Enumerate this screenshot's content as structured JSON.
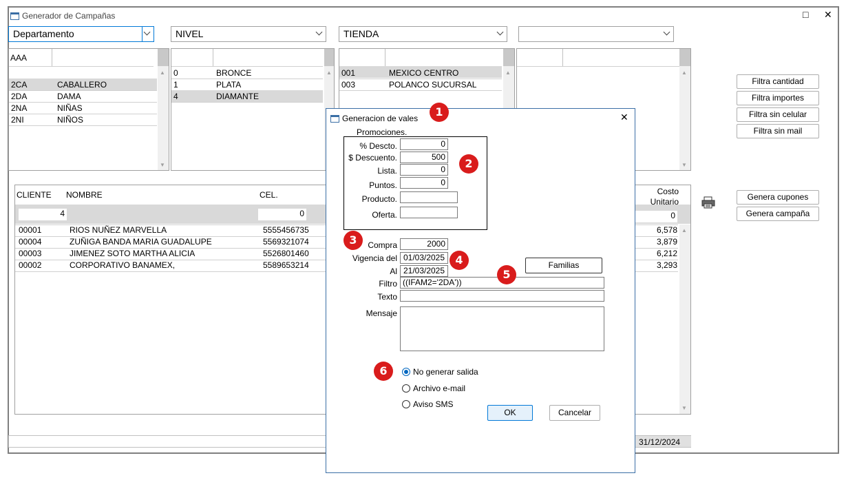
{
  "window": {
    "title": "Generador de Campañas",
    "maximize_icon": "□",
    "close_icon": "✕"
  },
  "combos": [
    {
      "value": "Departamento"
    },
    {
      "value": "NIVEL"
    },
    {
      "value": "TIENDA"
    },
    {
      "value": ""
    }
  ],
  "dept_grid": {
    "header": "AAA",
    "rows": [
      {
        "code": "2CA",
        "name": "CABALLERO"
      },
      {
        "code": "2DA",
        "name": "DAMA"
      },
      {
        "code": "2NA",
        "name": "NIÑAS"
      },
      {
        "code": "2NI",
        "name": "NIÑOS"
      }
    ]
  },
  "nivel_grid": {
    "rows": [
      {
        "code": "0",
        "name": "BRONCE"
      },
      {
        "code": "1",
        "name": "PLATA"
      },
      {
        "code": "4",
        "name": "DIAMANTE"
      }
    ]
  },
  "tienda_grid": {
    "rows": [
      {
        "code": "001",
        "name": "MEXICO CENTRO"
      },
      {
        "code": "003",
        "name": "POLANCO SUCURSAL"
      }
    ]
  },
  "filter_buttons": [
    "Filtra cantidad",
    "Filtra importes",
    "Filtra sin celular",
    "Filtra sin mail"
  ],
  "action_buttons": [
    "Genera cupones",
    "Genera campaña"
  ],
  "clients": {
    "headers": {
      "cliente": "CLIENTE",
      "nombre": "NOMBRE",
      "cel": "CEL.",
      "costo": "Costo Unitario"
    },
    "filter_cliente": "4",
    "filter_cel": "0",
    "filter_costo": "0",
    "rows": [
      {
        "cliente": "00001",
        "nombre": "RIOS NUÑEZ MARVELLA",
        "cel": "5555456735",
        "costo": "6,578"
      },
      {
        "cliente": "00004",
        "nombre": "ZUÑIGA BANDA MARIA GUADALUPE",
        "cel": "5569321074",
        "costo": "3,879"
      },
      {
        "cliente": "00003",
        "nombre": "JIMENEZ SOTO MARTHA ALICIA",
        "cel": "5526801460",
        "costo": "6,212"
      },
      {
        "cliente": "00002",
        "nombre": "CORPORATIVO BANAMEX,",
        "cel": "5589653214",
        "costo": "3,293"
      }
    ],
    "status_date": "31/12/2024"
  },
  "dialog": {
    "title": "Generacion de vales",
    "close_icon": "✕",
    "promociones_label": "Promociones.",
    "fields": {
      "pct_descto": {
        "label": "% Descto.",
        "value": "0"
      },
      "descuento": {
        "label": "$ Descuento.",
        "value": "500"
      },
      "lista": {
        "label": "Lista.",
        "value": "0"
      },
      "puntos": {
        "label": "Puntos.",
        "value": "0"
      },
      "producto": {
        "label": "Producto.",
        "value": ""
      },
      "oferta": {
        "label": "Oferta.",
        "value": ""
      },
      "compra": {
        "label": "Compra",
        "value": "2000"
      },
      "vigencia": {
        "label": "Vigencia del",
        "value": "01/03/2025"
      },
      "al": {
        "label": "Al",
        "value": "21/03/2025"
      },
      "filtro": {
        "label": "Filtro",
        "value": "((IFAM2='2DA'))"
      },
      "texto": {
        "label": "Texto",
        "value": ""
      },
      "mensaje": {
        "label": "Mensaje",
        "value": ""
      }
    },
    "familias_label": "Familias",
    "radios": [
      {
        "label": "No generar salida",
        "checked": true
      },
      {
        "label": "Archivo e-mail",
        "checked": false
      },
      {
        "label": "Aviso SMS",
        "checked": false
      }
    ],
    "ok_label": "OK",
    "cancel_label": "Cancelar"
  },
  "badges": [
    "1",
    "2",
    "3",
    "4",
    "5",
    "6"
  ],
  "colors": {
    "badge": "#d91c1c",
    "dialog_border": "#3a6ea5",
    "radio_on": "#0067c0"
  }
}
